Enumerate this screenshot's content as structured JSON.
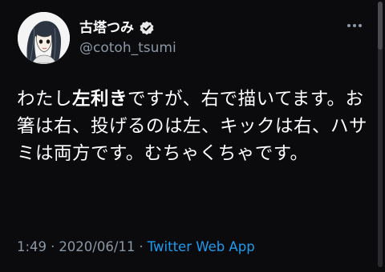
{
  "author": {
    "display_name": "古塔つみ",
    "handle": "@cotoh_tsumi",
    "verified_icon": "verified-badge-icon"
  },
  "tweet": {
    "text_before": "わたし",
    "text_emphasis": "左利き",
    "text_after": "ですが、右で描いてます。お箸は右、投げるのは左、キックは右、ハサミは両方です。むちゃくちゃです。"
  },
  "meta": {
    "time": "1:49",
    "separator": "·",
    "date": "2020/06/11",
    "source": "Twitter Web App"
  },
  "icons": {
    "more": "more-options-icon",
    "avatar": "avatar-illustration"
  },
  "colors": {
    "background": "#0b0b0d",
    "secondary_text": "#8b98a5",
    "link": "#1d9bf0"
  }
}
